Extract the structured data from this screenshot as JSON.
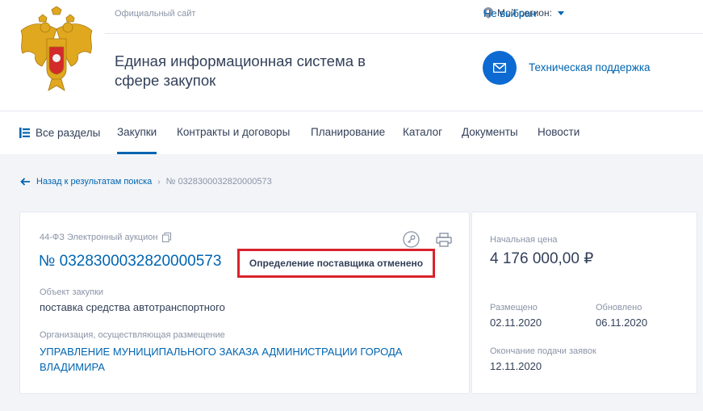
{
  "header": {
    "official_site": "Официальный сайт",
    "region_label": "Мой регион:",
    "region_value": "Не выбран",
    "site_title": "Единая информационная система в сфере закупок",
    "support": "Техническая поддержка"
  },
  "nav": {
    "all_sections": "Все разделы",
    "items": [
      "Закупки",
      "Контракты и договоры",
      "Планирование",
      "Каталог",
      "Документы",
      "Новости"
    ],
    "active": "Закупки"
  },
  "breadcrumb": {
    "back": "Назад к результатам поиска",
    "current": "№ 0328300032820000573"
  },
  "procurement": {
    "type": "44-ФЗ Электронный аукцион",
    "number": "№ 0328300032820000573",
    "status": "Определение поставщика отменено",
    "object_label": "Объект закупки",
    "object_value": "поставка средства автотранспортного",
    "org_label": "Организация, осуществляющая размещение",
    "org_value": "УПРАВЛЕНИЕ МУНИЦИПАЛЬНОГО ЗАКАЗА АДМИНИСТРАЦИИ ГОРОДА ВЛАДИМИРА"
  },
  "summary": {
    "price_label": "Начальная цена",
    "price_value": "4 176 000,00 ₽",
    "placed_label": "Размещено",
    "placed_value": "02.11.2020",
    "updated_label": "Обновлено",
    "updated_value": "06.11.2020",
    "deadline_label": "Окончание подачи заявок",
    "deadline_value": "12.11.2020"
  },
  "colors": {
    "accent": "#0065b1",
    "status_border": "#d9232d",
    "support_circle": "#0d6ad2"
  }
}
